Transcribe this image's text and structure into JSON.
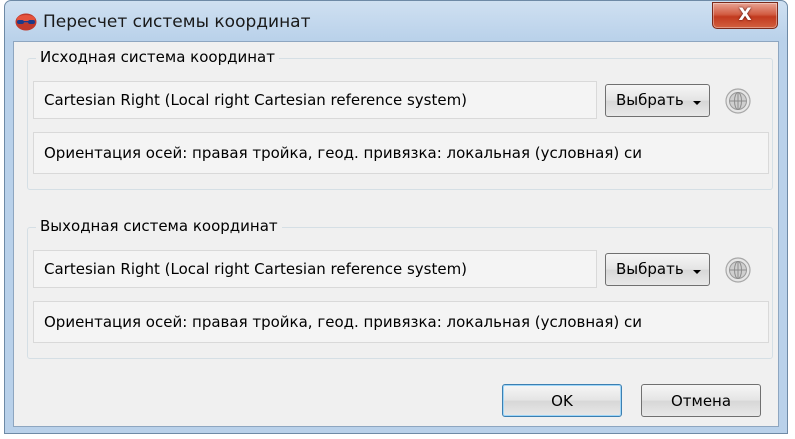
{
  "window": {
    "title": "Пересчет системы координат",
    "close_label": "X"
  },
  "source": {
    "group_label": "Исходная система координат",
    "system_name": "Cartesian Right (Local right Cartesian reference system)",
    "select_label": "Выбрать",
    "description": "Ориентация осей: правая тройка, геод. привязка: локальная (условная) си"
  },
  "target": {
    "group_label": "Выходная система координат",
    "system_name": "Cartesian Right (Local right Cartesian reference system)",
    "select_label": "Выбрать",
    "description": "Ориентация осей: правая тройка, геод. привязка: локальная (условная) си"
  },
  "buttons": {
    "ok": "OK",
    "cancel": "Отмена"
  },
  "icons": {
    "app": "app-icon",
    "globe": "globe-icon",
    "close": "close-icon"
  }
}
